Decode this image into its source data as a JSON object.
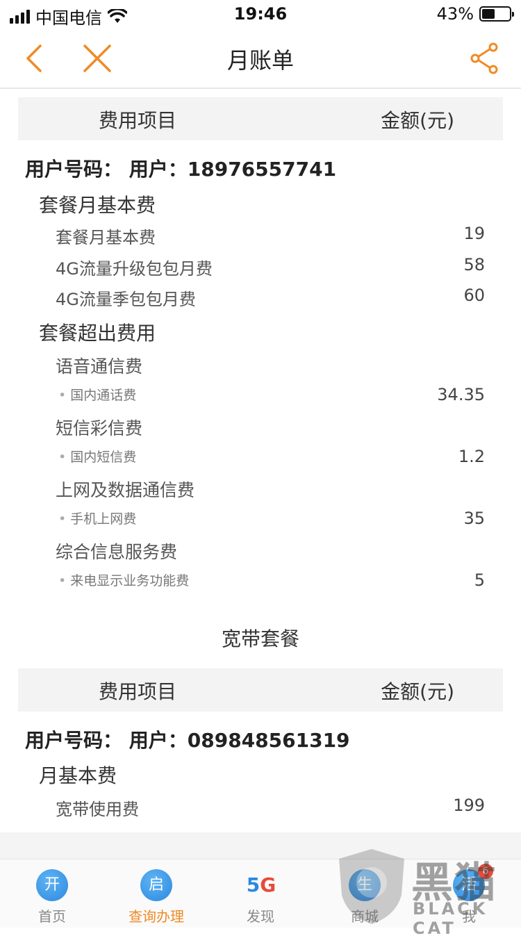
{
  "status": {
    "carrier": "中国电信",
    "time": "19:46",
    "battery": "43%",
    "battery_level": 0.43
  },
  "nav": {
    "title": "月账单"
  },
  "colors": {
    "accent": "#f08a24",
    "tab_icon_blue": "#2c88e0",
    "badge_red": "#e84a3a"
  },
  "mobile": {
    "header": {
      "col1": "费用项目",
      "col2": "金额(元)"
    },
    "user_line": "用户号码：  用户：18976557741",
    "package_basic": {
      "title": "套餐月基本费",
      "rows": [
        {
          "label": "套餐月基本费",
          "amount": "19"
        },
        {
          "label": "4G流量升级包包月费",
          "amount": "58"
        },
        {
          "label": "4G流量季包包月费",
          "amount": "60"
        }
      ]
    },
    "over_fees": {
      "title": "套餐超出费用",
      "groups": [
        {
          "category": "语音通信费",
          "item": "国内通话费",
          "amount": "34.35"
        },
        {
          "category": "短信彩信费",
          "item": "国内短信费",
          "amount": "1.2"
        },
        {
          "category": "上网及数据通信费",
          "item": "手机上网费",
          "amount": "35"
        },
        {
          "category": "综合信息服务费",
          "item": "来电显示业务功能费",
          "amount": "5"
        }
      ]
    }
  },
  "broadband": {
    "block_title": "宽带套餐",
    "header": {
      "col1": "费用项目",
      "col2": "金额(元)"
    },
    "user_line": "用户号码：  用户：089848561319",
    "section_title": "月基本费",
    "rows": [
      {
        "label": "宽带使用费",
        "amount": "199"
      }
    ]
  },
  "tabs": [
    {
      "label": "首页",
      "icon_char": "开",
      "icon": "home-icon"
    },
    {
      "label": "查询办理",
      "icon_char": "启",
      "icon": "query-icon",
      "active": true
    },
    {
      "label": "发现",
      "icon_char": "5G",
      "icon": "5g-icon"
    },
    {
      "label": "商城",
      "icon_char": "生",
      "icon": "mall-icon"
    },
    {
      "label": "我",
      "icon_char": "活",
      "icon": "me-icon",
      "badge": "6"
    }
  ],
  "watermark": {
    "text": "黑猫",
    "sub": "BLACK CAT"
  }
}
